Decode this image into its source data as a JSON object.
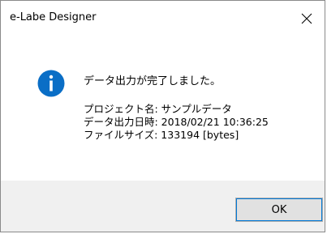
{
  "window": {
    "title": "e-Labe Designer"
  },
  "message": {
    "main": "データ出力が完了しました。",
    "details": [
      "プロジェクト名: サンプルデータ",
      "データ出力日時: 2018/02/21 10:36:25",
      "ファイルサイズ: 133194 [bytes]"
    ]
  },
  "buttons": {
    "ok_label": "OK"
  },
  "icons": {
    "message_icon": "info-icon",
    "close_icon": "close-icon"
  },
  "colors": {
    "info_blue": "#0a6ec6",
    "footer_bg": "#f0f0f0",
    "button_focus": "#0078d7"
  }
}
